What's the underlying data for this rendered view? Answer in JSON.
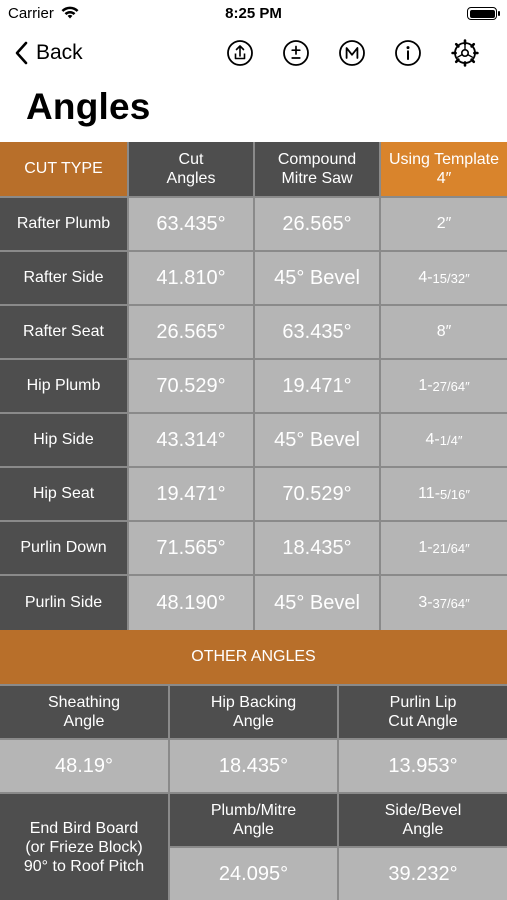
{
  "status": {
    "carrier": "Carrier",
    "time": "8:25 PM"
  },
  "nav": {
    "back_label": "Back",
    "icons": [
      "share-icon",
      "plus-minus-icon",
      "memory-icon",
      "info-icon",
      "settings-icon"
    ]
  },
  "page": {
    "title": "Angles"
  },
  "table": {
    "headers": {
      "cut_type": "CUT TYPE",
      "cut_angles_l1": "Cut",
      "cut_angles_l2": "Angles",
      "compound_l1": "Compound",
      "compound_l2": "Mitre Saw",
      "template_l1": "Using Template",
      "template_l2": "4″"
    },
    "rows": [
      {
        "label": "Rafter Plumb",
        "cut": "63.435°",
        "mitre": "26.565°",
        "tpl_whole": "2″",
        "tpl_frac": ""
      },
      {
        "label": "Rafter Side",
        "cut": "41.810°",
        "mitre": "45° Bevel",
        "tpl_whole": "4-",
        "tpl_frac": "15/32″"
      },
      {
        "label": "Rafter Seat",
        "cut": "26.565°",
        "mitre": "63.435°",
        "tpl_whole": "8″",
        "tpl_frac": ""
      },
      {
        "label": "Hip Plumb",
        "cut": "70.529°",
        "mitre": "19.471°",
        "tpl_whole": "1-",
        "tpl_frac": "27/64″"
      },
      {
        "label": "Hip Side",
        "cut": "43.314°",
        "mitre": "45° Bevel",
        "tpl_whole": "4-",
        "tpl_frac": "1/4″"
      },
      {
        "label": "Hip Seat",
        "cut": "19.471°",
        "mitre": "70.529°",
        "tpl_whole": "11-",
        "tpl_frac": "5/16″"
      },
      {
        "label": "Purlin Down",
        "cut": "71.565°",
        "mitre": "18.435°",
        "tpl_whole": "1-",
        "tpl_frac": "21/64″"
      },
      {
        "label": "Purlin Side",
        "cut": "48.190°",
        "mitre": "45° Bevel",
        "tpl_whole": "3-",
        "tpl_frac": "37/64″"
      }
    ]
  },
  "other": {
    "title": "OTHER ANGLES",
    "sheathing_l1": "Sheathing",
    "sheathing_l2": "Angle",
    "hip_backing_l1": "Hip Backing",
    "hip_backing_l2": "Angle",
    "purlin_lip_l1": "Purlin Lip",
    "purlin_lip_l2": "Cut Angle",
    "sheathing_value": "48.19°",
    "hip_backing_value": "18.435°",
    "purlin_lip_value": "13.953°",
    "end_bird_l1": "End Bird Board",
    "end_bird_l2": "(or Frieze Block)",
    "end_bird_l3": "90° to Roof Pitch",
    "plumb_mitre_l1": "Plumb/Mitre",
    "plumb_mitre_l2": "Angle",
    "side_bevel_l1": "Side/Bevel",
    "side_bevel_l2": "Angle",
    "plumb_mitre_value": "24.095°",
    "side_bevel_value": "39.232°"
  }
}
